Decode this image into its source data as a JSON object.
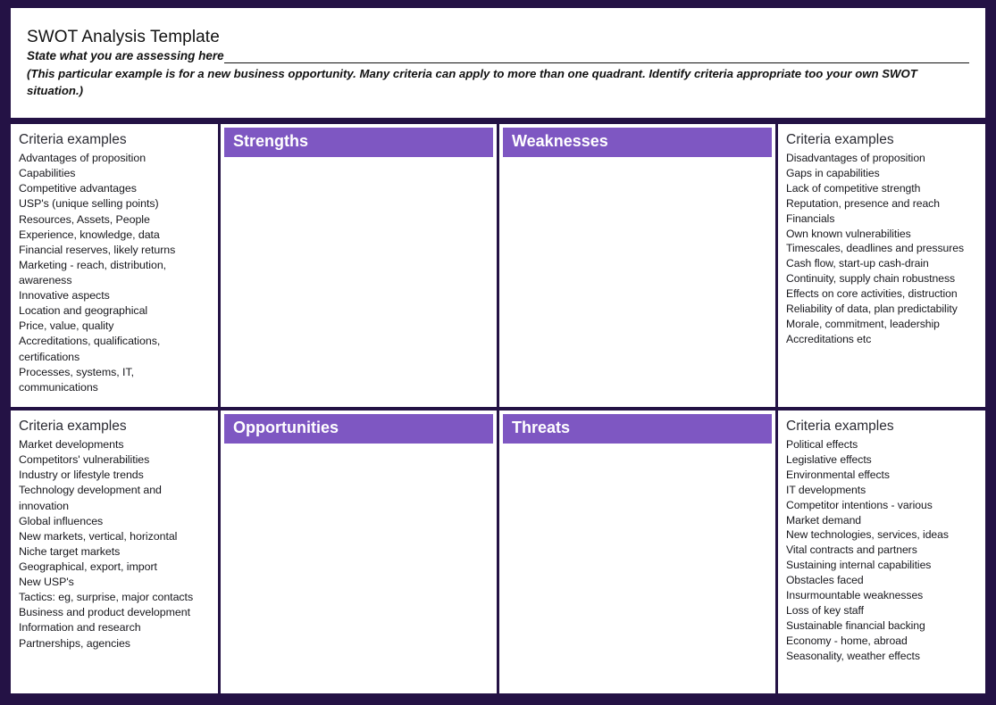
{
  "header": {
    "title": "SWOT Analysis Template",
    "assess_label": "State what you are assessing here",
    "note": "(This particular example is for a new business opportunity. Many criteria can apply to more than one quadrant. Identify criteria appropriate too your own SWOT situation.)"
  },
  "colors": {
    "frame": "#241245",
    "quadrant_header": "#7e57c2",
    "card_background": "#ffffff",
    "heading_text": "#2b2b33"
  },
  "quadrants": {
    "strengths": {
      "label": "Strengths"
    },
    "weaknesses": {
      "label": "Weaknesses"
    },
    "opportunities": {
      "label": "Opportunities"
    },
    "threats": {
      "label": "Threats"
    }
  },
  "criteria": {
    "strengths": {
      "title": "Criteria examples",
      "items": [
        "Advantages of proposition",
        "Capabilities",
        "Competitive advantages",
        "USP's (unique selling points)",
        "Resources, Assets, People",
        "Experience, knowledge, data",
        "Financial reserves, likely returns",
        "Marketing -  reach, distribution, awareness",
        "Innovative aspects",
        "Location and geographical",
        "Price, value, quality",
        "Accreditations, qualifications, certifications",
        "Processes, systems, IT, communications"
      ]
    },
    "weaknesses": {
      "title": "Criteria examples",
      "items": [
        "Disadvantages of proposition",
        "Gaps in capabilities",
        "Lack of competitive strength",
        "Reputation, presence and reach",
        "Financials",
        "Own known vulnerabilities",
        "Timescales, deadlines and pressures",
        "Cash flow, start-up cash-drain",
        "Continuity, supply chain robustness",
        "Effects on core activities, distruction",
        "Reliability of data, plan predictability",
        "Morale, commitment, leadership",
        "Accreditations etc"
      ]
    },
    "opportunities": {
      "title": "Criteria examples",
      "items": [
        "Market developments",
        "Competitors' vulnerabilities",
        "Industry or lifestyle trends",
        "Technology development and innovation",
        "Global influences",
        "New markets, vertical, horizontal",
        "Niche target markets",
        "Geographical, export, import",
        "New USP's",
        "Tactics: eg, surprise, major contacts",
        "Business and product development",
        "Information and research",
        "Partnerships, agencies"
      ]
    },
    "threats": {
      "title": "Criteria examples",
      "items": [
        "Political effects",
        "Legislative effects",
        "Environmental effects",
        "IT developments",
        "Competitor intentions - various",
        "Market demand",
        "New technologies, services, ideas",
        "Vital contracts and partners",
        "Sustaining internal capabilities",
        "Obstacles faced",
        "Insurmountable weaknesses",
        "Loss of key staff",
        "Sustainable financial backing",
        "Economy - home, abroad",
        "Seasonality, weather effects"
      ]
    }
  }
}
